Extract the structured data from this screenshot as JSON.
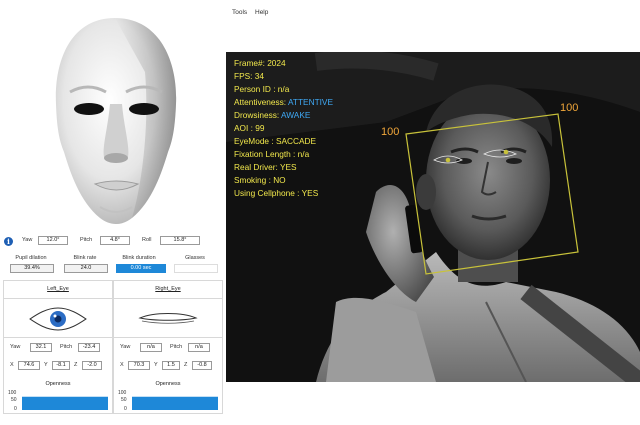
{
  "menu": {
    "tools": "Tools",
    "help": "Help"
  },
  "pose": {
    "yaw_label": "Yaw",
    "yaw": "12.0°",
    "pitch_label": "Pitch",
    "pitch": "4.8°",
    "roll_label": "Roll",
    "roll": "15.8°"
  },
  "metrics": {
    "pupil_label": "Pupil dilation",
    "pupil": "39.4%",
    "blink_rate_label": "Blink rate",
    "blink_rate": "24.0",
    "blink_dur_label": "Blink duration",
    "blink_dur": "0.00 sec",
    "glasses_label": "Glasses",
    "glasses": "",
    "accent_color": "#1e88d8"
  },
  "left_eye": {
    "title": "Left_Eye",
    "yaw_label": "Yaw",
    "yaw": "32.1",
    "pitch_label": "Pitch",
    "pitch": "-23.4",
    "x_label": "X",
    "x": "74.6",
    "y_label": "Y",
    "y": "-8.1",
    "z_label": "Z",
    "z": "-2.0",
    "openness_label": "Openness",
    "openness_ticks": [
      "100",
      "50",
      "0"
    ],
    "openness_level": 0.78,
    "state": "open"
  },
  "right_eye": {
    "title": "Right_Eye",
    "yaw_label": "Yaw",
    "yaw": "n/a",
    "pitch_label": "Pitch",
    "pitch": "n/a",
    "x_label": "X",
    "x": "70.3",
    "y_label": "Y",
    "y": "1.5",
    "z_label": "Z",
    "z": "-0.8",
    "openness_label": "Openness",
    "openness_ticks": [
      "100",
      "50",
      "0"
    ],
    "openness_level": 0.78,
    "state": "closed"
  },
  "overlay": {
    "frame": "Frame#:  2024",
    "fps": "FPS:  34",
    "person_id": "Person ID : n/a",
    "attentiveness_label": "Attentiveness:",
    "attentiveness_value": "ATTENTIVE",
    "drowsiness_label": "Drowsiness:",
    "drowsiness_value": "AWAKE",
    "aoi": "AOI : 99",
    "eye_mode": "EyeMode : SACCADE",
    "fixation": "Fixation Length : n/a",
    "real_driver": "Real Driver: YES",
    "smoking": "Smoking : NO",
    "cellphone": "Using Cellphone : YES",
    "score_left": "100",
    "score_right": "100",
    "text_color": "#f2e84c",
    "value_color": "#3fa9f5",
    "box_color": "#c8c23a"
  }
}
